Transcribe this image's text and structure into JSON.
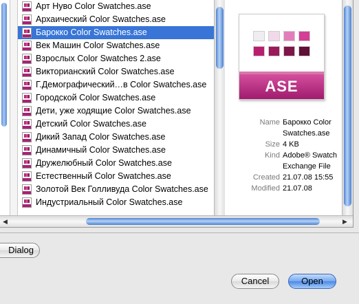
{
  "files": [
    "Арт Нуво Color Swatches.ase",
    "Архаический Color Swatches.ase",
    "Барокко Color Swatches.ase",
    "Век Машин Color Swatches.ase",
    "Взрослых Color Swatches 2.ase",
    "Викторианский Color Swatches.ase",
    "Г.Демографический…в Color Swatches.ase",
    "Городской Color Swatches.ase",
    "Дети, уже ходящие Color Swatches.ase",
    "Детский Color Swatches.ase",
    "Дикий Запад Color Swatches.ase",
    "Динамичный Color Swatches.ase",
    "Дружелюбный Color Swatches.ase",
    "Естественный Color Swatches.ase",
    "Золотой Век Голливуда Color Swatches.ase",
    "Индустриальный Color Swatches.ase"
  ],
  "selected_index": 2,
  "preview": {
    "icon_label": "ASE",
    "swatch_colors": [
      "#eeeef0",
      "#f2d9ea",
      "#e27fbb",
      "#d23f95",
      "#b8206f",
      "#9a1a5a",
      "#7d1748",
      "#5f1138"
    ],
    "band_color": "#b8206f",
    "meta": [
      {
        "label": "Name",
        "value": "Барокко Color Swatches.ase"
      },
      {
        "label": "Size",
        "value": "4 KB"
      },
      {
        "label": "Kind",
        "value": "Adobe® Swatch Exchange File"
      },
      {
        "label": "Created",
        "value": "21.07.08 15:55"
      },
      {
        "label": "Modified",
        "value": "21.07.08"
      }
    ]
  },
  "buttons": {
    "dialog_label": "Dialog",
    "cancel_label": "Cancel",
    "open_label": "Open"
  },
  "colors": {
    "selection": "#3875d7",
    "scroll_thumb": "#6b9be0"
  }
}
